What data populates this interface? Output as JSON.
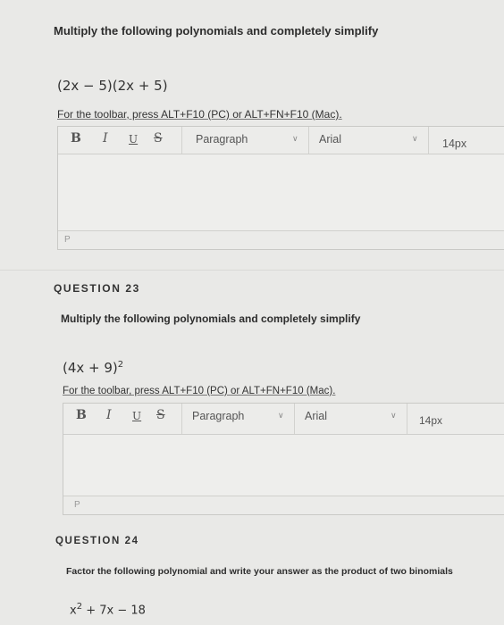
{
  "q22": {
    "instruction": "Multiply the following polynomials and completely simplify",
    "expr": "(2x − 5)(2x + 5)",
    "toolbar_note": "For the toolbar, press ALT+F10 (PC) or ALT+FN+F10 (Mac).",
    "bold": "B",
    "italic": "I",
    "underline": "U",
    "strike": "S",
    "paragraph": "Paragraph",
    "font": "Arial",
    "size": "14px",
    "status": "P"
  },
  "q23": {
    "heading": "QUESTION 23",
    "instruction": "Multiply the following polynomials and completely simplify",
    "expr_base": "(4x + 9)",
    "expr_exp": "2",
    "toolbar_note": "For the toolbar, press ALT+F10 (PC) or ALT+FN+F10 (Mac).",
    "bold": "B",
    "italic": "I",
    "underline": "U",
    "strike": "S",
    "paragraph": "Paragraph",
    "font": "Arial",
    "size": "14px",
    "status": "P"
  },
  "q24": {
    "heading": "QUESTION 24",
    "instruction": "Factor the following polynomial and write your answer as the product of two binomials",
    "expr_base": "x",
    "expr_exp": "2",
    "expr_rest": " + 7x − 18"
  },
  "icons": {
    "chevron": "chevron-down-icon"
  }
}
